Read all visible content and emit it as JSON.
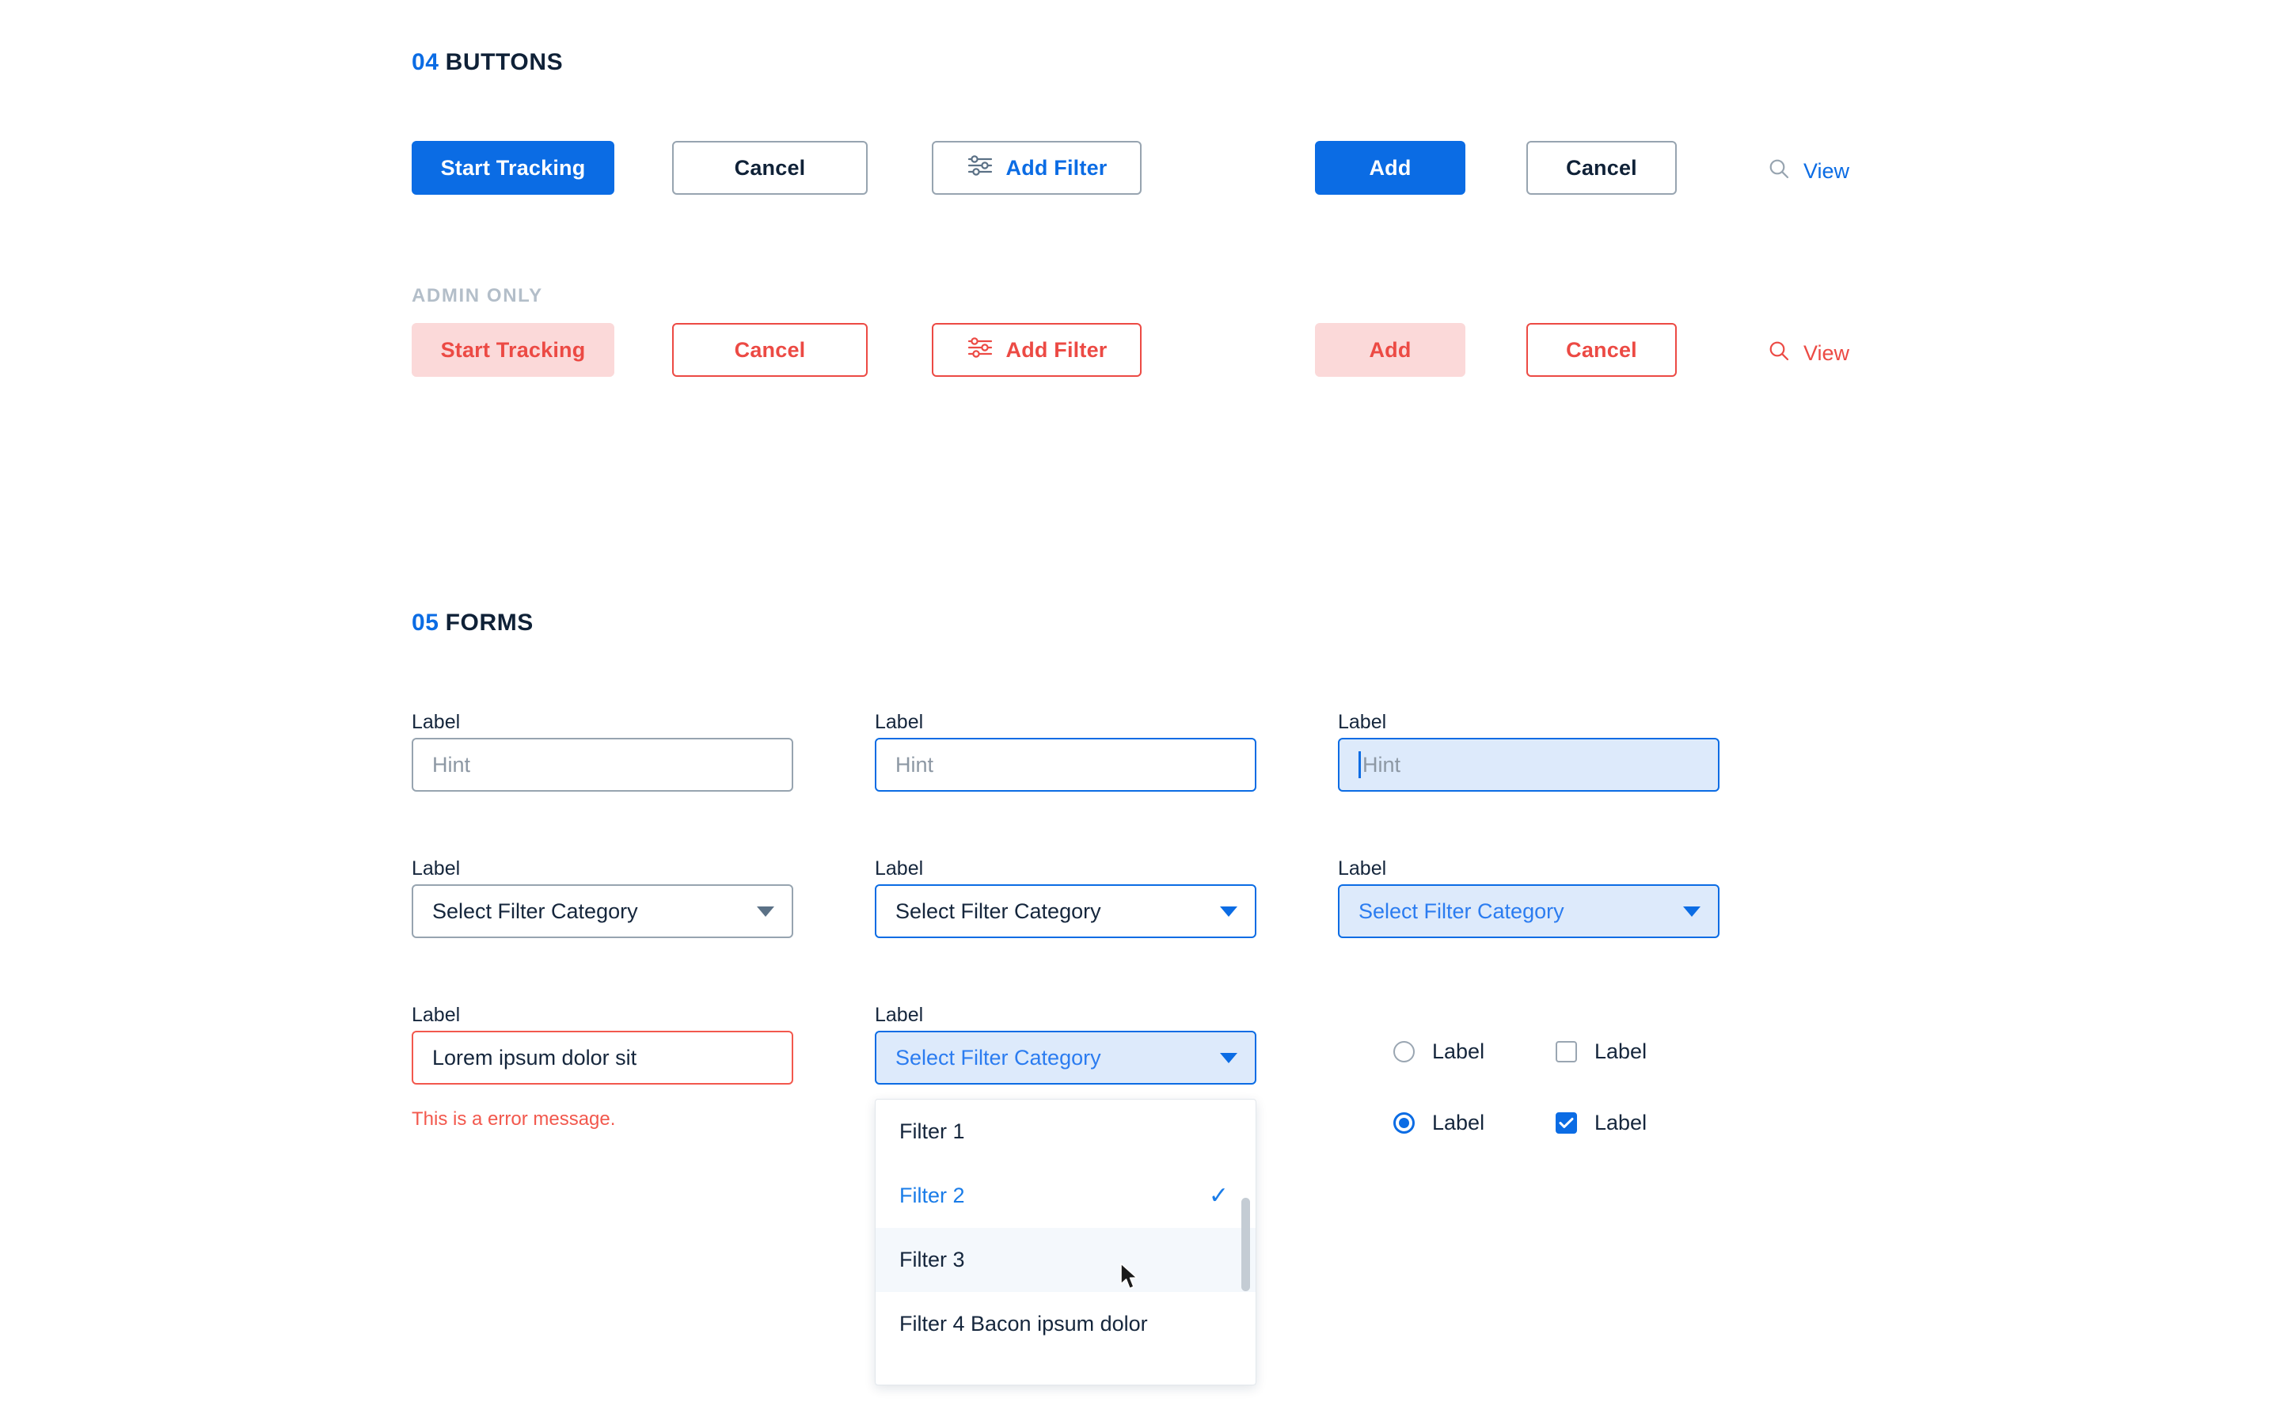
{
  "sections": {
    "buttons": {
      "num": "04",
      "title": "BUTTONS"
    },
    "forms": {
      "num": "05",
      "title": "FORMS"
    }
  },
  "buttons_section": {
    "admin_label": "ADMIN ONLY",
    "primary_row": {
      "start_tracking": "Start Tracking",
      "cancel": "Cancel",
      "add_filter": "Add Filter",
      "add": "Add",
      "cancel2": "Cancel",
      "view": "View"
    },
    "admin_row": {
      "start_tracking": "Start Tracking",
      "cancel": "Cancel",
      "add_filter": "Add Filter",
      "add": "Add",
      "cancel2": "Cancel",
      "view": "View"
    },
    "icons": {
      "filter": "filter-sliders-icon",
      "search": "search-icon"
    }
  },
  "forms_section": {
    "labels": {
      "l1": "Label",
      "l2": "Label",
      "l3": "Label",
      "l4": "Label",
      "l5": "Label",
      "l6": "Label",
      "l7": "Label",
      "l8": "Label"
    },
    "inputs": {
      "hint1": "Hint",
      "hint2": "Hint",
      "hint3": "Hint",
      "error_value": "Lorem ipsum dolor sit",
      "error_message": "This is a error message."
    },
    "selects": {
      "s1": "Select Filter Category",
      "s2": "Select Filter Category",
      "s3": "Select Filter Category",
      "s4": "Select Filter Category"
    },
    "dropdown": {
      "options": [
        {
          "label": "Filter 1",
          "selected": false,
          "hovered": false
        },
        {
          "label": "Filter 2",
          "selected": true,
          "hovered": false
        },
        {
          "label": "Filter 3",
          "selected": false,
          "hovered": true
        },
        {
          "label": "Filter 4 Bacon ipsum dolor",
          "selected": false,
          "hovered": false
        }
      ],
      "check_glyph": "✓"
    },
    "options": {
      "radio_unchecked_label": "Label",
      "radio_checked_label": "Label",
      "checkbox_unchecked_label": "Label",
      "checkbox_checked_label": "Label"
    }
  },
  "colors": {
    "accent_blue": "#0b6ce4",
    "danger_red": "#ec4a44",
    "error_red": "#f2584d",
    "text_dark": "#15263c",
    "border_gray": "#97a4b0",
    "muted_gray": "#b3bec9",
    "focus_fill": "#ddeafb"
  }
}
